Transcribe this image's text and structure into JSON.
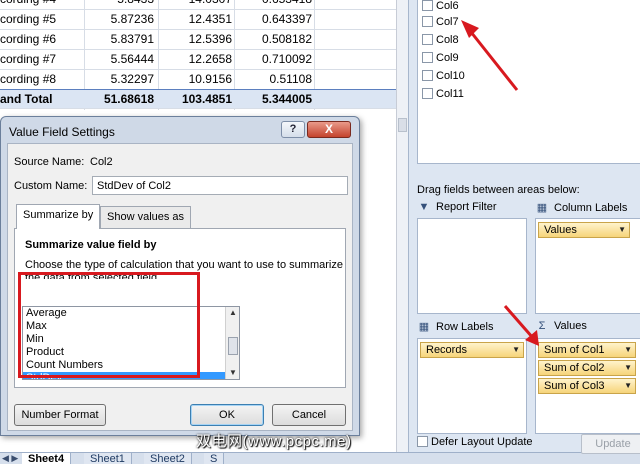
{
  "spreadsheet": {
    "rows": [
      {
        "label": "cording #4",
        "v1": "5.8433",
        "v2": "14.0307",
        "v3": "0.653418"
      },
      {
        "label": "cording #5",
        "v1": "5.87236",
        "v2": "12.4351",
        "v3": "0.643397"
      },
      {
        "label": "cording #6",
        "v1": "5.83791",
        "v2": "12.5396",
        "v3": "0.508182"
      },
      {
        "label": "cording #7",
        "v1": "5.56444",
        "v2": "12.2658",
        "v3": "0.710092"
      },
      {
        "label": "cording #8",
        "v1": "5.32297",
        "v2": "10.9156",
        "v3": "0.51108"
      }
    ],
    "total": {
      "label": "and Total",
      "v1": "51.68618",
      "v2": "103.4851",
      "v3": "5.344005"
    }
  },
  "sheet_tabs": {
    "nav": "◀ ▶",
    "tabs": [
      "Sheet4",
      "Sheet1",
      "Sheet2",
      "S"
    ]
  },
  "dialog": {
    "title": "Value Field Settings",
    "help_label": "?",
    "close_label": "X",
    "source_name_label": "Source Name:",
    "source_name_value": "Col2",
    "custom_name_label": "Custom Name:",
    "custom_name_value": "StdDev of Col2",
    "tabs": [
      "Summarize by",
      "Show values as"
    ],
    "section_title": "Summarize value field by",
    "description": "Choose the type of calculation that you want to use to summarize the data from selected field",
    "functions": [
      "Average",
      "Max",
      "Min",
      "Product",
      "Count Numbers",
      "StdDev"
    ],
    "selected_function": "StdDev",
    "number_format_label": "Number Format",
    "ok_label": "OK",
    "cancel_label": "Cancel"
  },
  "field_list": {
    "fields": [
      "Col6",
      "Col7",
      "Col8",
      "Col9",
      "Col10",
      "Col11"
    ],
    "drag_hint": "Drag fields between areas below:",
    "report_filter_label": "Report Filter",
    "column_labels_label": "Column Labels",
    "row_labels_label": "Row Labels",
    "values_label": "Values",
    "column_values_pill": "Values",
    "row_pill": "Records",
    "value_pills": [
      "Sum of Col1",
      "Sum of Col2",
      "Sum of Col3"
    ],
    "defer_label": "Defer Layout Update",
    "update_label": "Update"
  },
  "colors": {
    "annotation_red": "#d8191f",
    "selection_blue": "#3399ff",
    "pill_yellow": "#f6d47a"
  },
  "watermark": "双电网(www.pcpc.me)"
}
